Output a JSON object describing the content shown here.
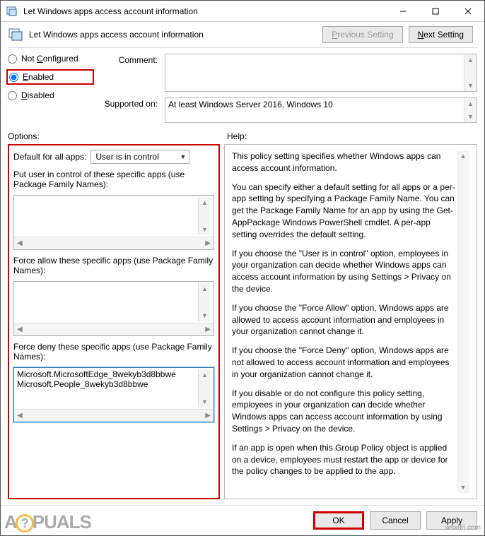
{
  "window": {
    "title": "Let Windows apps access account information"
  },
  "header": {
    "title": "Let Windows apps access account information",
    "prev_btn": "Previous Setting",
    "next_btn": "Next Setting"
  },
  "radios": {
    "not_configured": "Not Configured",
    "enabled": "Enabled",
    "disabled": "Disabled",
    "selected": "enabled"
  },
  "comment": {
    "label": "Comment:",
    "value": ""
  },
  "supported": {
    "label": "Supported on:",
    "value": "At least Windows Server 2016, Windows 10"
  },
  "labels": {
    "options": "Options:",
    "help": "Help:"
  },
  "options": {
    "default_label": "Default for all apps:",
    "default_select": "User is in control",
    "user_control_label": "Put user in control of these specific apps (use Package Family Names):",
    "user_control_value": "",
    "force_allow_label": "Force allow these specific apps (use Package Family Names):",
    "force_allow_value": "",
    "force_deny_label": "Force deny these specific apps (use Package Family Names):",
    "force_deny_value": "Microsoft.MicrosoftEdge_8wekyb3d8bbwe\nMicrosoft.People_8wekyb3d8bbwe"
  },
  "help": {
    "paragraphs": [
      "This policy setting specifies whether Windows apps can access account information.",
      "You can specify either a default setting for all apps or a per-app setting by specifying a Package Family Name. You can get the Package Family Name for an app by using the Get-AppPackage Windows PowerShell cmdlet. A per-app setting overrides the default setting.",
      "If you choose the \"User is in control\" option, employees in your organization can decide whether Windows apps can access account information by using Settings > Privacy on the device.",
      "If you choose the \"Force Allow\" option, Windows apps are allowed to access account information and employees in your organization cannot change it.",
      "If you choose the \"Force Deny\" option, Windows apps are not allowed to access account information and employees in your organization cannot change it.",
      "If you disable or do not configure this policy setting, employees in your organization can decide whether Windows apps can access account information by using Settings > Privacy on the device.",
      "If an app is open when this Group Policy object is applied on a device, employees must restart the app or device for the policy changes to be applied to the app."
    ]
  },
  "footer": {
    "ok": "OK",
    "cancel": "Cancel",
    "apply": "Apply"
  },
  "watermark": {
    "brand_prefix": "A",
    "brand_mid": "?",
    "brand_suffix": "PUALS",
    "source": "wsxdn.com"
  }
}
